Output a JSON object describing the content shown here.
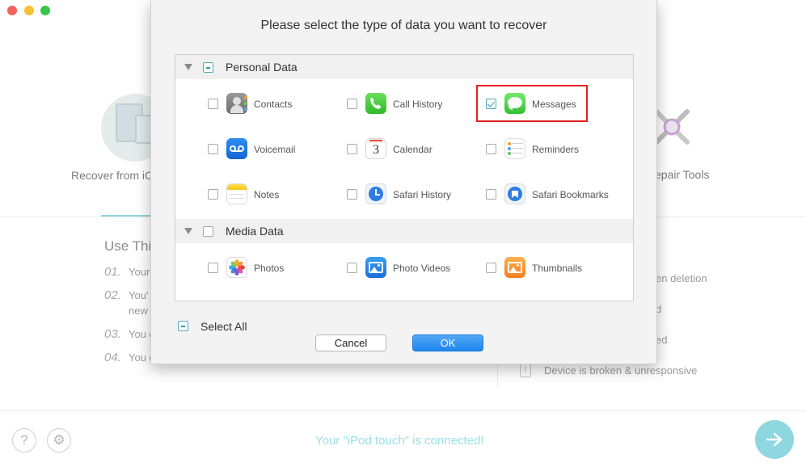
{
  "window": {
    "traffic_colors": [
      "#f5615c",
      "#f8bf32",
      "#36c84b"
    ]
  },
  "background": {
    "mode_left_label": "Recover from iC",
    "mode_right_label": "epair Tools",
    "use_this": "Use Thi",
    "numbered": [
      {
        "num": "01.",
        "text": "Your"
      },
      {
        "num": "02.",
        "text": "You'"
      },
      {
        "num": "",
        "text": "new"
      },
      {
        "num": "03.",
        "text": "You d"
      },
      {
        "num": "04.",
        "text": "You d"
      }
    ],
    "right_items": [
      "en deletion",
      "d",
      "ed",
      "Device is broken & unresponsive"
    ],
    "status": "Your \"iPod touch\" is connected!",
    "status_color": "#9be0e6",
    "help_glyph": "?",
    "settings_glyph": "⚙"
  },
  "dialog": {
    "title": "Please select the type of data you want to recover",
    "sections": [
      {
        "label": "Personal Data",
        "state": "partial",
        "items": [
          {
            "label": "Contacts",
            "icon": "contacts-icon",
            "checked": false
          },
          {
            "label": "Call History",
            "icon": "call-history-icon",
            "checked": false
          },
          {
            "label": "Messages",
            "icon": "messages-icon",
            "checked": true
          },
          {
            "label": "Voicemail",
            "icon": "voicemail-icon",
            "checked": false
          },
          {
            "label": "Calendar",
            "icon": "calendar-icon",
            "checked": false
          },
          {
            "label": "Reminders",
            "icon": "reminders-icon",
            "checked": false
          },
          {
            "label": "Notes",
            "icon": "notes-icon",
            "checked": false
          },
          {
            "label": "Safari History",
            "icon": "safari-history-icon",
            "checked": false
          },
          {
            "label": "Safari Bookmarks",
            "icon": "safari-bookmarks-icon",
            "checked": false
          }
        ]
      },
      {
        "label": "Media Data",
        "state": "unchecked",
        "items": [
          {
            "label": "Photos",
            "icon": "photos-icon",
            "checked": false
          },
          {
            "label": "Photo Videos",
            "icon": "photo-videos-icon",
            "checked": false
          },
          {
            "label": "Thumbnails",
            "icon": "thumbnails-icon",
            "checked": false
          }
        ]
      }
    ],
    "calendar_day": "3",
    "select_all_label": "Select All",
    "cancel_label": "Cancel",
    "ok_label": "OK",
    "highlight_color": "#e0221f"
  }
}
